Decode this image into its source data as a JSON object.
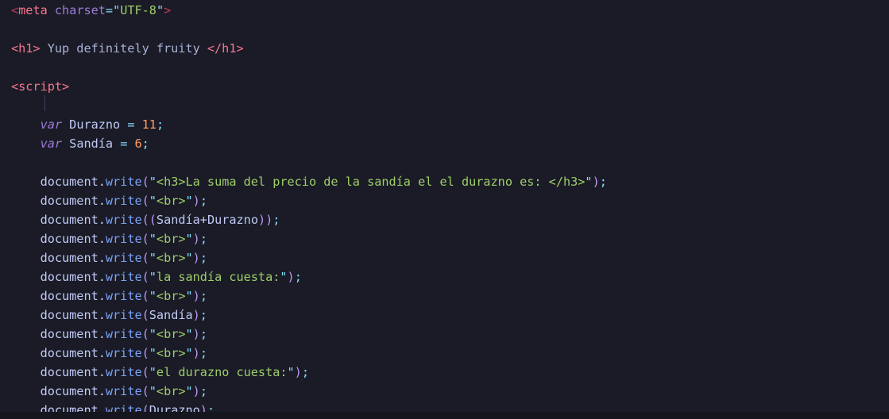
{
  "editor": {
    "theme_name": "tokyo-night",
    "background": "#1a1b26",
    "language": "html"
  },
  "colors": {
    "background": "#1a1b26",
    "tag": "#f7768e",
    "bracket": "#ba3c5b",
    "attribute": "#7aa2f7",
    "string": "#9ece6a",
    "keyword": "#9d7cd8",
    "identifier": "#c0caf5",
    "property": "#7aa2f7",
    "number": "#ff9e64",
    "punctuation": "#89ddff",
    "text": "#a9b1d6",
    "status_bar_background": "#16161e",
    "status_bar_text": "#565f89"
  },
  "code": {
    "line_01": {
      "open_bracket": "<",
      "tag_name": "meta",
      "space": " ",
      "attr_name": "charset",
      "equals": "=",
      "quote_open": "\"",
      "attr_value": "UTF-8",
      "quote_close": "\"",
      "close_bracket": ">"
    },
    "line_03": {
      "open_tag": "<h1>",
      "content": " Yup definitely fruity ",
      "close_tag": "</h1>"
    },
    "line_05": {
      "tag": "<script>"
    },
    "line_07": {
      "keyword": "var",
      "name": "Durazno",
      "equals": "=",
      "value": "11",
      "semicolon": ";"
    },
    "line_08": {
      "keyword": "var",
      "name": "Sandía",
      "equals": "=",
      "value": "6",
      "semicolon": ";"
    },
    "write_lines": [
      {
        "object": "document",
        "dot": ".",
        "method": "write",
        "open_paren": "(",
        "arg_type": "string",
        "arg": "<h3>La suma del precio de la sandía el el durazno es: </h3>",
        "close_paren": ")",
        "semicolon": ";"
      },
      {
        "object": "document",
        "dot": ".",
        "method": "write",
        "open_paren": "(",
        "arg_type": "string",
        "arg": "<br>",
        "close_paren": ")",
        "semicolon": ";"
      },
      {
        "object": "document",
        "dot": ".",
        "method": "write",
        "open_paren": "(",
        "arg_type": "expression",
        "expr_open_paren": "(",
        "expr_left": "Sandía",
        "expr_operator": "+",
        "expr_right": "Durazno",
        "expr_close_paren": ")",
        "close_paren": ")",
        "semicolon": ";"
      },
      {
        "object": "document",
        "dot": ".",
        "method": "write",
        "open_paren": "(",
        "arg_type": "string",
        "arg": "<br>",
        "close_paren": ")",
        "semicolon": ";"
      },
      {
        "object": "document",
        "dot": ".",
        "method": "write",
        "open_paren": "(",
        "arg_type": "string",
        "arg": "<br>",
        "close_paren": ")",
        "semicolon": ";"
      },
      {
        "object": "document",
        "dot": ".",
        "method": "write",
        "open_paren": "(",
        "arg_type": "string",
        "arg": "la sandía cuesta:",
        "close_paren": ")",
        "semicolon": ";"
      },
      {
        "object": "document",
        "dot": ".",
        "method": "write",
        "open_paren": "(",
        "arg_type": "string",
        "arg": "<br>",
        "close_paren": ")",
        "semicolon": ";"
      },
      {
        "object": "document",
        "dot": ".",
        "method": "write",
        "open_paren": "(",
        "arg_type": "identifier",
        "arg": "Sandía",
        "close_paren": ")",
        "semicolon": ";"
      },
      {
        "object": "document",
        "dot": ".",
        "method": "write",
        "open_paren": "(",
        "arg_type": "string",
        "arg": "<br>",
        "close_paren": ")",
        "semicolon": ";"
      },
      {
        "object": "document",
        "dot": ".",
        "method": "write",
        "open_paren": "(",
        "arg_type": "string",
        "arg": "<br>",
        "close_paren": ")",
        "semicolon": ";"
      },
      {
        "object": "document",
        "dot": ".",
        "method": "write",
        "open_paren": "(",
        "arg_type": "string",
        "arg": "el durazno cuesta:",
        "close_paren": ")",
        "semicolon": ";"
      },
      {
        "object": "document",
        "dot": ".",
        "method": "write",
        "open_paren": "(",
        "arg_type": "string",
        "arg": "<br>",
        "close_paren": ")",
        "semicolon": ";"
      },
      {
        "object": "document",
        "dot": ".",
        "method": "write",
        "open_paren": "(",
        "arg_type": "identifier",
        "arg": "Durazno",
        "close_paren": ")",
        "semicolon": ";"
      }
    ]
  }
}
